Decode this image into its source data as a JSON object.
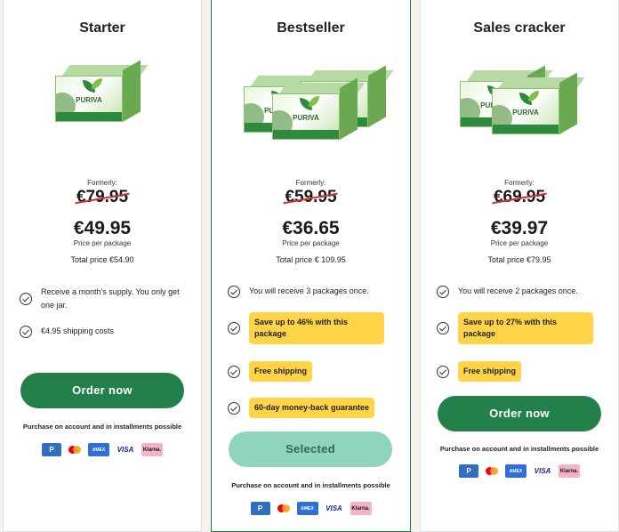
{
  "cards": [
    {
      "title": "Starter",
      "brand": "PURIVA",
      "formerly": "Formerly:",
      "old_price": "€79.95",
      "price": "€49.95",
      "price_per": "Price per package",
      "total": "Total price €54.90",
      "features": [
        {
          "text": "Receive a month's supply. You only get one jar.",
          "highlight": false
        },
        {
          "text": "€4.95 shipping costs",
          "highlight": false
        }
      ],
      "button": "Order now",
      "button_selected": false,
      "purchase": "Purchase on account and in installments possible"
    },
    {
      "title": "Bestseller",
      "brand": "PURIVA",
      "formerly": "Formerly:",
      "old_price": "€59.95",
      "price": "€36.65",
      "price_per": "Price per package",
      "total": "Total price € 109.95",
      "features": [
        {
          "text": "You will receive 3 packages once.",
          "highlight": false
        },
        {
          "text": "Save up to 46% with this package",
          "highlight": true
        },
        {
          "text": "Free shipping",
          "highlight": true
        },
        {
          "text": "60-day money-back guarantee",
          "highlight": true
        }
      ],
      "button": "Selected",
      "button_selected": true,
      "purchase": "Purchase on account and in installments possible"
    },
    {
      "title": "Sales cracker",
      "brand": "PURIVA",
      "formerly": "Formerly:",
      "old_price": "€69.95",
      "price": "€39.97",
      "price_per": "Price per package",
      "total": "Total price €79.95",
      "features": [
        {
          "text": "You will receive 2 packages once.",
          "highlight": false
        },
        {
          "text": "Save up to 27% with this package",
          "highlight": true
        },
        {
          "text": "Free shipping",
          "highlight": true
        }
      ],
      "button": "Order now",
      "button_selected": false,
      "purchase": "Purchase on account and in installments possible"
    }
  ],
  "payment_methods": [
    {
      "name": "paypal-icon",
      "label": "P"
    },
    {
      "name": "mastercard-icon",
      "label": ""
    },
    {
      "name": "amex-icon",
      "label": "AMEX"
    },
    {
      "name": "visa-icon",
      "label": "VISA"
    },
    {
      "name": "klarna-icon",
      "label": "Klarna."
    }
  ],
  "colors": {
    "accent_green": "#23804a",
    "selected_button": "#8fd4bd",
    "highlight_yellow": "#ffd447",
    "strike_red": "#d03030"
  }
}
